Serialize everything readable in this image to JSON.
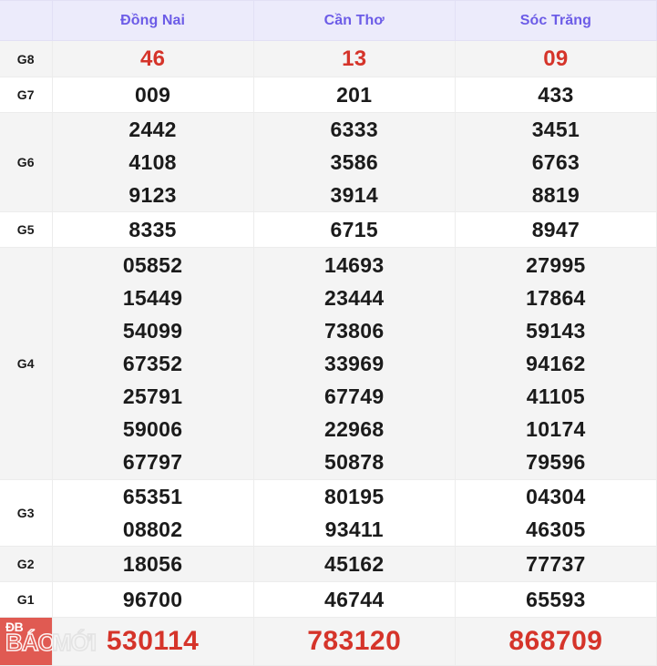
{
  "table": {
    "corner_label": "",
    "columns": [
      {
        "key": "dong_nai",
        "label": "Đồng Nai"
      },
      {
        "key": "can_tho",
        "label": "Cần Thơ"
      },
      {
        "key": "soc_trang",
        "label": "Sóc Trăng"
      }
    ],
    "header_text_color": "#6c5ce7",
    "header_bg_color": "#ecebfb",
    "highlight_color": "#d5342a",
    "rows": [
      {
        "label": "G8",
        "style": "red",
        "dong_nai": [
          "46"
        ],
        "can_tho": [
          "13"
        ],
        "soc_trang": [
          "09"
        ]
      },
      {
        "label": "G7",
        "style": "normal",
        "dong_nai": [
          "009"
        ],
        "can_tho": [
          "201"
        ],
        "soc_trang": [
          "433"
        ]
      },
      {
        "label": "G6",
        "style": "normal",
        "dong_nai": [
          "2442",
          "4108",
          "9123"
        ],
        "can_tho": [
          "6333",
          "3586",
          "3914"
        ],
        "soc_trang": [
          "3451",
          "6763",
          "8819"
        ]
      },
      {
        "label": "G5",
        "style": "normal",
        "dong_nai": [
          "8335"
        ],
        "can_tho": [
          "6715"
        ],
        "soc_trang": [
          "8947"
        ]
      },
      {
        "label": "G4",
        "style": "normal",
        "dong_nai": [
          "05852",
          "15449",
          "54099",
          "67352",
          "25791",
          "59006",
          "67797"
        ],
        "can_tho": [
          "14693",
          "23444",
          "73806",
          "33969",
          "67749",
          "22968",
          "50878"
        ],
        "soc_trang": [
          "27995",
          "17864",
          "59143",
          "94162",
          "41105",
          "10174",
          "79596"
        ]
      },
      {
        "label": "G3",
        "style": "normal",
        "dong_nai": [
          "65351",
          "08802"
        ],
        "can_tho": [
          "80195",
          "93411"
        ],
        "soc_trang": [
          "04304",
          "46305"
        ]
      },
      {
        "label": "G2",
        "style": "normal",
        "dong_nai": [
          "18056"
        ],
        "can_tho": [
          "45162"
        ],
        "soc_trang": [
          "77737"
        ]
      },
      {
        "label": "G1",
        "style": "normal",
        "dong_nai": [
          "96700"
        ],
        "can_tho": [
          "46744"
        ],
        "soc_trang": [
          "65593"
        ]
      }
    ],
    "special_row": {
      "label": "ĐB",
      "dong_nai": "530114",
      "can_tho": "783120",
      "soc_trang": "868709"
    }
  },
  "watermark": {
    "line1": "ĐB",
    "line2": "BÁO",
    "overflow": "MỚI"
  }
}
